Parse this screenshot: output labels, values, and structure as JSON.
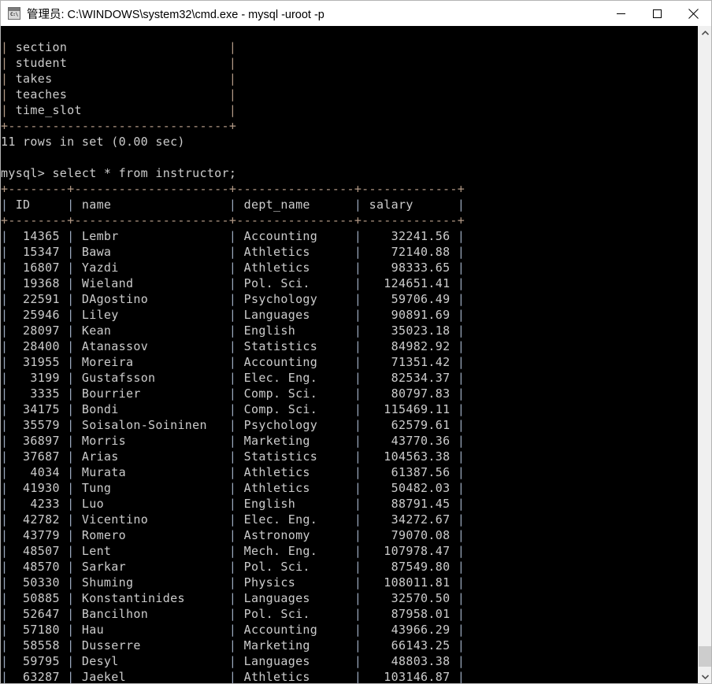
{
  "window": {
    "title": "管理员: C:\\WINDOWS\\system32\\cmd.exe - mysql  -uroot -p",
    "icon": "cmd-console-icon",
    "icon_prompt": "C:\\",
    "controls": {
      "minimize_label": "Minimize",
      "maximize_label": "Maximize",
      "close_label": "Close"
    },
    "titlebar_bg": "#ffffff",
    "terminal_bg": "#000000",
    "terminal_fg": "#cccccc"
  },
  "scrollbar": {
    "up_arrow": "chevron-up-icon",
    "down_arrow": "chevron-down-icon",
    "thumb_position": "bottom"
  },
  "terminal": {
    "previous_result": {
      "trailing_rows": [
        "section",
        "student",
        "takes",
        "teaches",
        "time_slot"
      ],
      "separator_width": 30,
      "status": "11 rows in set (0.00 sec)"
    },
    "prompt": "mysql>",
    "command": "select * from instructor;",
    "table": {
      "columns": [
        {
          "label": "ID",
          "width": 8,
          "align": "right"
        },
        {
          "label": "name",
          "width": 21,
          "align": "left"
        },
        {
          "label": "dept_name",
          "width": 16,
          "align": "left"
        },
        {
          "label": "salary",
          "width": 13,
          "align": "right"
        }
      ],
      "rows": [
        [
          "14365",
          "Lembr",
          "Accounting",
          "32241.56"
        ],
        [
          "15347",
          "Bawa",
          "Athletics",
          "72140.88"
        ],
        [
          "16807",
          "Yazdi",
          "Athletics",
          "98333.65"
        ],
        [
          "19368",
          "Wieland",
          "Pol. Sci.",
          "124651.41"
        ],
        [
          "22591",
          "DAgostino",
          "Psychology",
          "59706.49"
        ],
        [
          "25946",
          "Liley",
          "Languages",
          "90891.69"
        ],
        [
          "28097",
          "Kean",
          "English",
          "35023.18"
        ],
        [
          "28400",
          "Atanassov",
          "Statistics",
          "84982.92"
        ],
        [
          "31955",
          "Moreira",
          "Accounting",
          "71351.42"
        ],
        [
          "3199",
          "Gustafsson",
          "Elec. Eng.",
          "82534.37"
        ],
        [
          "3335",
          "Bourrier",
          "Comp. Sci.",
          "80797.83"
        ],
        [
          "34175",
          "Bondi",
          "Comp. Sci.",
          "115469.11"
        ],
        [
          "35579",
          "Soisalon-Soininen",
          "Psychology",
          "62579.61"
        ],
        [
          "36897",
          "Morris",
          "Marketing",
          "43770.36"
        ],
        [
          "37687",
          "Arias",
          "Statistics",
          "104563.38"
        ],
        [
          "4034",
          "Murata",
          "Athletics",
          "61387.56"
        ],
        [
          "41930",
          "Tung",
          "Athletics",
          "50482.03"
        ],
        [
          "4233",
          "Luo",
          "English",
          "88791.45"
        ],
        [
          "42782",
          "Vicentino",
          "Elec. Eng.",
          "34272.67"
        ],
        [
          "43779",
          "Romero",
          "Astronomy",
          "79070.08"
        ],
        [
          "48507",
          "Lent",
          "Mech. Eng.",
          "107978.47"
        ],
        [
          "48570",
          "Sarkar",
          "Pol. Sci.",
          "87549.80"
        ],
        [
          "50330",
          "Shuming",
          "Physics",
          "108011.81"
        ],
        [
          "50885",
          "Konstantinides",
          "Languages",
          "32570.50"
        ],
        [
          "52647",
          "Bancilhon",
          "Pol. Sci.",
          "87958.01"
        ],
        [
          "57180",
          "Hau",
          "Accounting",
          "43966.29"
        ],
        [
          "58558",
          "Dusserre",
          "Marketing",
          "66143.25"
        ],
        [
          "59795",
          "Desyl",
          "Languages",
          "48803.38"
        ],
        [
          "63287",
          "Jaekel",
          "Athletics",
          "103146.87"
        ]
      ]
    }
  }
}
